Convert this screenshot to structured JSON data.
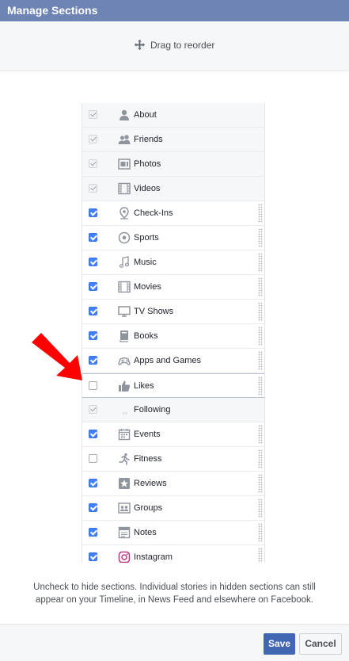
{
  "dialog": {
    "title": "Manage Sections",
    "drag_hint": "Drag to reorder",
    "footnote_line1": "Uncheck to hide sections. Individual stories in hidden sections can still",
    "footnote_line2": "appear on your Timeline, in News Feed and elsewhere on Facebook.",
    "save_label": "Save",
    "cancel_label": "Cancel"
  },
  "colors": {
    "header": "#6d84b4",
    "checkbox_checked": "#4080ff",
    "save_button": "#4267b2",
    "arrow": "#ff0000"
  },
  "sections": [
    {
      "label": "About",
      "icon": "person-icon",
      "checked": true,
      "locked": true
    },
    {
      "label": "Friends",
      "icon": "friends-icon",
      "checked": true,
      "locked": true
    },
    {
      "label": "Photos",
      "icon": "photos-icon",
      "checked": true,
      "locked": true
    },
    {
      "label": "Videos",
      "icon": "film-icon",
      "checked": true,
      "locked": true
    },
    {
      "label": "Check-Ins",
      "icon": "map-pin-icon",
      "checked": true,
      "locked": false
    },
    {
      "label": "Sports",
      "icon": "soccer-ball-icon",
      "checked": true,
      "locked": false
    },
    {
      "label": "Music",
      "icon": "music-note-icon",
      "checked": true,
      "locked": false
    },
    {
      "label": "Movies",
      "icon": "film-icon",
      "checked": true,
      "locked": false
    },
    {
      "label": "TV Shows",
      "icon": "tv-icon",
      "checked": true,
      "locked": false
    },
    {
      "label": "Books",
      "icon": "book-icon",
      "checked": true,
      "locked": false
    },
    {
      "label": "Apps and Games",
      "icon": "game-controller-icon",
      "checked": true,
      "locked": false
    },
    {
      "label": "Likes",
      "icon": "thumbs-up-icon",
      "checked": false,
      "locked": false
    },
    {
      "label": "Following",
      "icon": "following-icon",
      "checked": true,
      "locked": true
    },
    {
      "label": "Events",
      "icon": "calendar-icon",
      "checked": true,
      "locked": false
    },
    {
      "label": "Fitness",
      "icon": "running-person-icon",
      "checked": false,
      "locked": false
    },
    {
      "label": "Reviews",
      "icon": "star-icon",
      "checked": true,
      "locked": false
    },
    {
      "label": "Groups",
      "icon": "groups-icon",
      "checked": true,
      "locked": false
    },
    {
      "label": "Notes",
      "icon": "notes-icon",
      "checked": true,
      "locked": false
    },
    {
      "label": "Instagram",
      "icon": "instagram-icon",
      "checked": true,
      "locked": false
    }
  ]
}
